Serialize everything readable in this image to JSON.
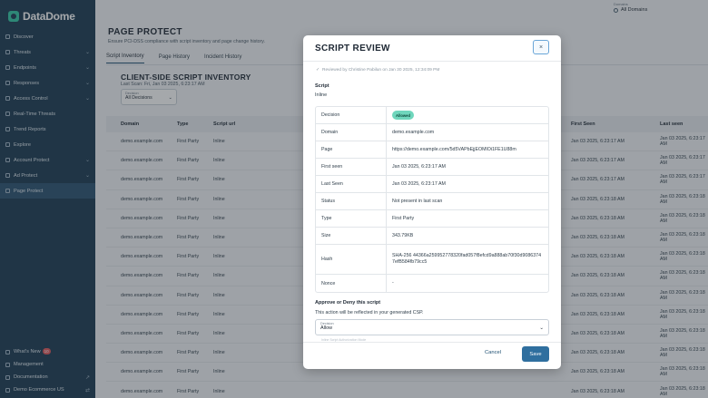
{
  "sidebar": {
    "logo_text": "DataDome",
    "items": [
      {
        "label": "Discover",
        "chev": ""
      },
      {
        "label": "Threats",
        "chev": "⌄"
      },
      {
        "label": "Endpoints",
        "chev": "⌄"
      },
      {
        "label": "Responses",
        "chev": "⌄"
      },
      {
        "label": "Access Control",
        "chev": "⌄"
      },
      {
        "label": "Real-Time Threats",
        "chev": ""
      },
      {
        "label": "Trend Reports",
        "chev": ""
      },
      {
        "label": "Explore",
        "chev": ""
      },
      {
        "label": "Account Protect",
        "chev": "⌄"
      },
      {
        "label": "Ad Protect",
        "chev": "⌄"
      },
      {
        "label": "Page Protect",
        "chev": ""
      }
    ],
    "bottom": {
      "whats_new": "What's New",
      "whats_new_count": "10",
      "management": "Management",
      "documentation": "Documentation",
      "account": "Demo Ecommerce US"
    }
  },
  "header": {
    "domains_label": "Domains",
    "domains_value": "All Domains"
  },
  "page": {
    "title": "PAGE PROTECT",
    "subtitle": "Ensure PCI-DSS compliance with script inventory and page change history.",
    "tabs": [
      "Script Inventory",
      "Page History",
      "Incident History"
    ],
    "inventory_title": "CLIENT-SIDE SCRIPT INVENTORY",
    "last_scan": "Last Scan: Fri, Jan 03 2025, 6:23:17 AM",
    "decision_filter_label": "Decision",
    "decision_filter_value": "All Decisions"
  },
  "table": {
    "headers": [
      "Domain",
      "Type",
      "Script url",
      "First Seen",
      "Last seen"
    ],
    "rows": [
      [
        "demo.example.com",
        "First Party",
        "Inline",
        "Jan 03 2025, 6:23:17 AM",
        "Jan 03 2025, 6:23:17 AM"
      ],
      [
        "demo.example.com",
        "First Party",
        "Inline",
        "Jan 03 2025, 6:23:17 AM",
        "Jan 03 2025, 6:23:17 AM"
      ],
      [
        "demo.example.com",
        "First Party",
        "Inline",
        "Jan 03 2025, 6:23:17 AM",
        "Jan 03 2025, 6:23:17 AM"
      ],
      [
        "demo.example.com",
        "First Party",
        "Inline",
        "Jan 03 2025, 6:23:18 AM",
        "Jan 03 2025, 6:23:18 AM"
      ],
      [
        "demo.example.com",
        "First Party",
        "Inline",
        "Jan 03 2025, 6:23:18 AM",
        "Jan 03 2025, 6:23:18 AM"
      ],
      [
        "demo.example.com",
        "First Party",
        "Inline",
        "Jan 03 2025, 6:23:18 AM",
        "Jan 03 2025, 6:23:18 AM"
      ],
      [
        "demo.example.com",
        "First Party",
        "Inline",
        "Jan 03 2025, 6:23:18 AM",
        "Jan 03 2025, 6:23:18 AM"
      ],
      [
        "demo.example.com",
        "First Party",
        "Inline",
        "Jan 03 2025, 6:23:18 AM",
        "Jan 03 2025, 6:23:18 AM"
      ],
      [
        "demo.example.com",
        "First Party",
        "Inline",
        "Jan 03 2025, 6:23:18 AM",
        "Jan 03 2025, 6:23:18 AM"
      ],
      [
        "demo.example.com",
        "First Party",
        "Inline",
        "Jan 03 2025, 6:23:18 AM",
        "Jan 03 2025, 6:23:18 AM"
      ],
      [
        "demo.example.com",
        "First Party",
        "Inline",
        "Jan 03 2025, 6:23:18 AM",
        "Jan 03 2025, 6:23:18 AM"
      ],
      [
        "demo.example.com",
        "First Party",
        "Inline",
        "Jan 03 2025, 6:23:18 AM",
        "Jan 03 2025, 6:23:18 AM"
      ],
      [
        "demo.example.com",
        "First Party",
        "Inline",
        "Jan 03 2025, 6:23:18 AM",
        "Jan 03 2025, 6:23:18 AM"
      ],
      [
        "demo.example.com",
        "First Party",
        "Inline",
        "Jan 03 2025, 6:23:18 AM",
        "Jan 03 2025, 6:23:18 AM"
      ]
    ]
  },
  "modal": {
    "title": "SCRIPT REVIEW",
    "close": "×",
    "reviewed": "Reviewed by Christine Pabilun on Jan 30 2025, 12:34:09 PM",
    "script_label": "Script",
    "script_value": "Inline",
    "details": [
      {
        "key": "Decision",
        "value": "Allowed",
        "badge": true
      },
      {
        "key": "Domain",
        "value": "demo.example.com"
      },
      {
        "key": "Page",
        "value": "https://demo.example.com/5d5VAPbEjjEOMlOi1FE1U88m"
      },
      {
        "key": "First seen",
        "value": "Jan 03 2025, 6:23:17 AM"
      },
      {
        "key": "Last Seen",
        "value": "Jan 03 2025, 6:23:17 AM"
      },
      {
        "key": "Status",
        "value": "Not present in last scan"
      },
      {
        "key": "Type",
        "value": "First Party"
      },
      {
        "key": "Size",
        "value": "343.79KB"
      },
      {
        "key": "Hash",
        "value": "SHA-256 44366a259952778320fad057f8efcd9a888ab70f30d90863747efB584fb79cc5"
      },
      {
        "key": "Nonce",
        "value": "-"
      }
    ],
    "approve_label": "Approve or Deny this script",
    "approve_note": "This action will be reflected in your generated CSP.",
    "decision_label": "Decision",
    "decision_value": "Allow",
    "helper": "Inline Script Authorization Mode",
    "cancel": "Cancel",
    "save": "Save"
  }
}
